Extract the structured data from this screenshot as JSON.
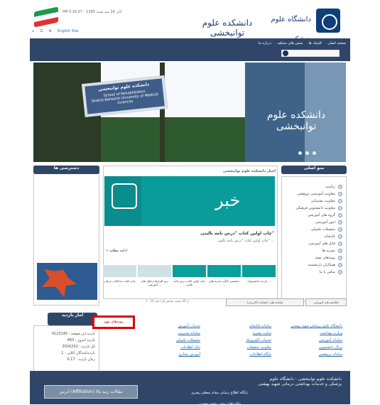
{
  "header": {
    "right_calligraphy": "دانشگاه علوم پزشکی",
    "center_calligraphy": "دانشکده علوم توانبخشی",
    "top_text": "PM 5:16:57 - 1395 آبان 14 سه شنبه",
    "links": [
      "English Site",
      "⌂",
      "☰",
      "⚙"
    ]
  },
  "nav": {
    "menu": [
      "صفحه اصلی",
      "کلینیک ها",
      "بخش های مختلف",
      "درباره ما"
    ],
    "search_placeholder": ""
  },
  "hero": {
    "sign_fa": "دانشکده علوم توانبخشی",
    "sign_en1": "School of Rehabilitation",
    "sign_en2": "Shahid Beheshti University of Medical Sciences",
    "panel_text": "دانشکده علوم توانبخشی"
  },
  "left": {
    "title": "دسترسی ها"
  },
  "news": {
    "title": "اخبار دانشکده علوم توانبخشی",
    "image_text": "خبر",
    "headline": "چاپ اولین کتاب \"درس نامه بالینی\"",
    "subline": "چاپ اولین کتاب \"درس نامه بالینی\" ...",
    "more": "« ادامه مطلب"
  },
  "thumbs": [
    {
      "caption": "چاپ کتاب مداخلات حرکتی ..."
    },
    {
      "caption": "نرم افزارها و فایل های آموزشی ..."
    },
    {
      "caption": "چاپ اولین کتاب درس نامه بالینی"
    },
    {
      "caption": "ششمین کنگره تجربه های ..."
    },
    {
      "caption": "بازدید دانشجویان ..."
    }
  ],
  "pager": "1 - 10 از 10 جست نمایش کل اخبار",
  "right": {
    "title": "منو اصلی",
    "items": [
      "ریاست",
      "معاونت آموزشی پژوهشی",
      "معاونت پشتیبانی",
      "معاونت دانشجویی فرهنگی",
      "گروه های آموزشی",
      "امور آموزشی",
      "تحصیلات تکمیلی",
      "کتابخانه",
      "فایل های آموزشی",
      "نشریه ها",
      "پیوندهای مفید",
      "همکاران بازنشسته",
      "تماس با ما"
    ]
  },
  "visits": {
    "title": "آمار بازدید",
    "lines": [
      "بازدید این صفحه : 0123145",
      "بازدید امروز : 463",
      "کل بازدید : 3016252",
      "بازدیدکنندگان آنلاین : 1",
      "زمان بازدید : 0.17"
    ]
  },
  "announcements": {
    "tabs": [
      "اطلاعیه های آموزشی",
      "سامانه های دانشکده (کاربران)",
      "پیوندهای مهم"
    ],
    "active": "پیوندهای مهم",
    "col1": [
      "دانشگاه علوم پزشکی شهید بهشتی",
      "وزارت بهداشت",
      "سامانه آموزشی",
      "پرتال دانشجویی",
      "سامانه پژوهشی"
    ],
    "col2": [
      "سامانه کتابخانه",
      "سایت نشریه",
      "خدمات الکترونیک",
      "معاونت تحقیقات",
      "پایگاه اطلاعات"
    ],
    "col3": [
      "خدمات آموزش",
      "سامانه مدیریت",
      "تحصیلات تکمیلی",
      "بانک اطلاعات",
      "آموزش مجازی"
    ]
  },
  "footer": {
    "text": "دانشکده علوم توانبخشی - دانشگاه علوم پزشکی و خدمات بهداشتی درمانی شهید بهشتی",
    "portal": "پایگاه اطلاع رسانی مقام معظم رهبری",
    "ad": "آدرس (Affiliation) مقالات رتبه بالا",
    "tiny": "پایگاه اطلاع رسانی ریاست جمهوری"
  }
}
